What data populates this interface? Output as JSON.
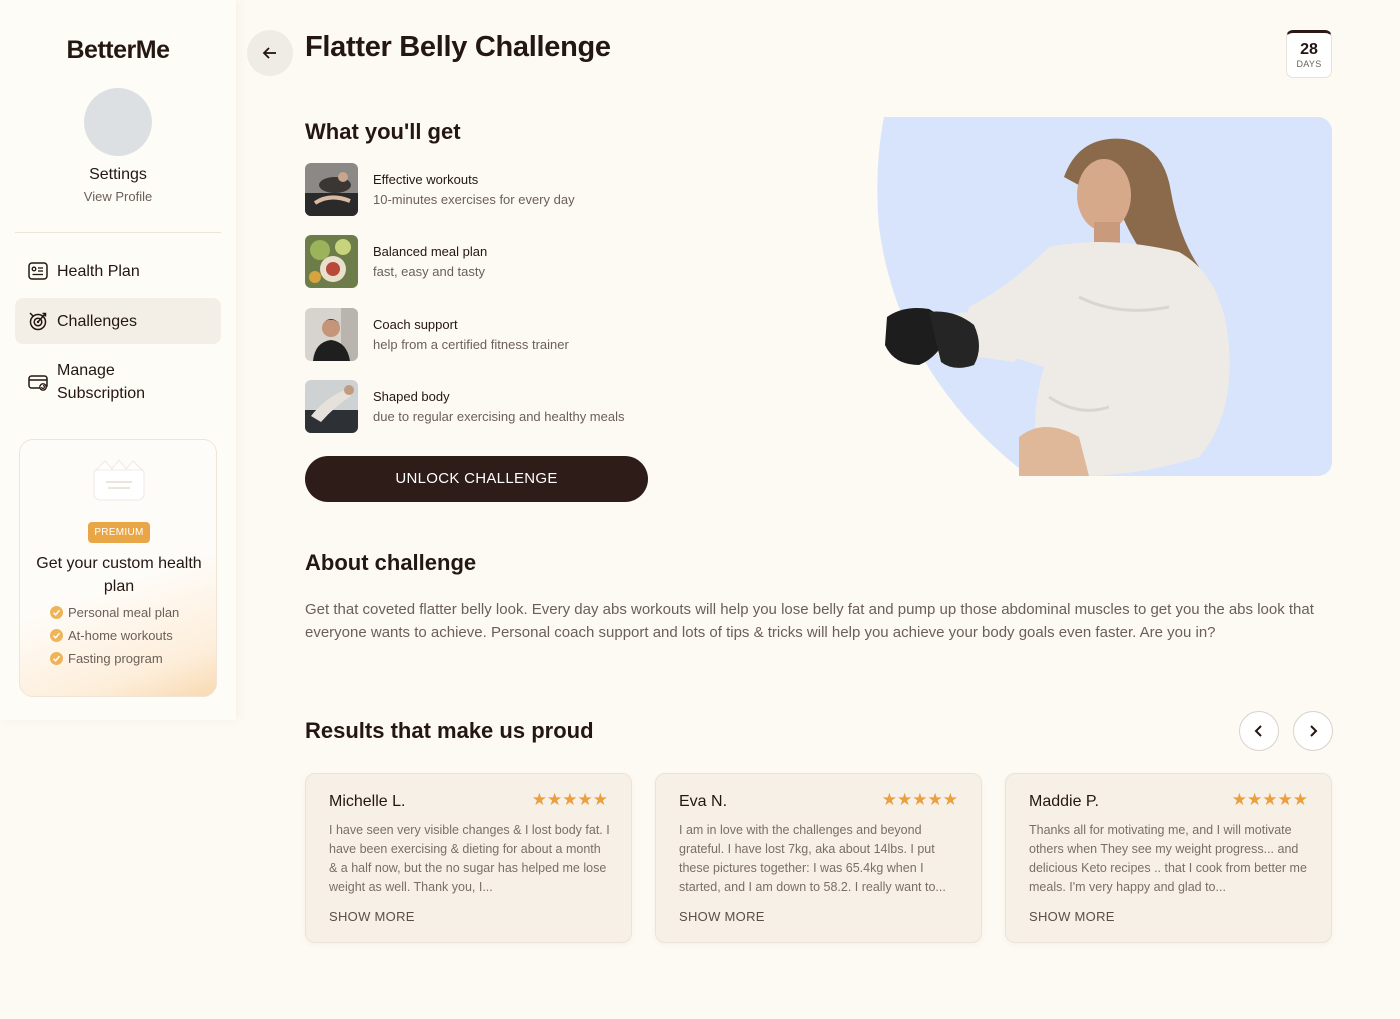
{
  "sidebar": {
    "logo": "BetterMe",
    "profile": {
      "name": "Settings",
      "link": "View Profile"
    },
    "nav": [
      {
        "label": "Health Plan",
        "icon": "health-plan-icon",
        "active": false
      },
      {
        "label": "Challenges",
        "icon": "challenges-icon",
        "active": true
      },
      {
        "label": "Manage Subscription",
        "icon": "subscription-icon",
        "active": false
      }
    ],
    "premium": {
      "badge": "PREMIUM",
      "title": "Get your custom health plan",
      "features": [
        "Personal meal plan",
        "At-home workouts",
        "Fasting program"
      ]
    }
  },
  "header": {
    "title": "Flatter Belly Challenge",
    "days": {
      "value": "28",
      "label": "DAYS"
    }
  },
  "benefits": {
    "heading": "What you'll get",
    "items": [
      {
        "title": "Effective workouts",
        "desc": "10-minutes exercises for every day"
      },
      {
        "title": "Balanced meal plan",
        "desc": "fast, easy and tasty"
      },
      {
        "title": "Coach support",
        "desc": "help from a certified fitness trainer"
      },
      {
        "title": "Shaped body",
        "desc": "due to regular exercising and healthy meals"
      }
    ],
    "cta": "UNLOCK CHALLENGE"
  },
  "about": {
    "heading": "About challenge",
    "text": "Get that coveted flatter belly look. Every day abs workouts will help you lose belly fat and pump up those abdominal muscles to get you the abs look that everyone wants to achieve. Personal coach support and lots of tips & tricks will help you achieve your body goals even faster. Are you in?"
  },
  "results": {
    "heading": "Results that make us proud",
    "reviews": [
      {
        "name": "Michelle L.",
        "stars": "★★★★★",
        "text": "I have seen very visible changes & I lost body fat. I have been exercising & dieting for about a month & a half now, but the no sugar has helped me lose weight as well. Thank you, I...",
        "more": "SHOW MORE"
      },
      {
        "name": "Eva N.",
        "stars": "★★★★★",
        "text": "I am in love with the challenges and beyond grateful. I have lost 7kg, aka about 14lbs. I put these pictures together: I was 65.4kg when I started, and I am down to 58.2. I really want to...",
        "more": "SHOW MORE"
      },
      {
        "name": "Maddie P.",
        "stars": "★★★★★",
        "text": "Thanks all for motivating me, and I will motivate others when They see my weight progress... and delicious Keto recipes .. that I cook from better me meals. I'm very happy and glad to...",
        "more": "SHOW MORE"
      }
    ]
  },
  "colors": {
    "background": "#fdfaf3",
    "primary_dark": "#2d1c17",
    "accent_orange": "#e8a647",
    "hero_blue": "#d8e4fb",
    "card": "#f7f0e6"
  }
}
